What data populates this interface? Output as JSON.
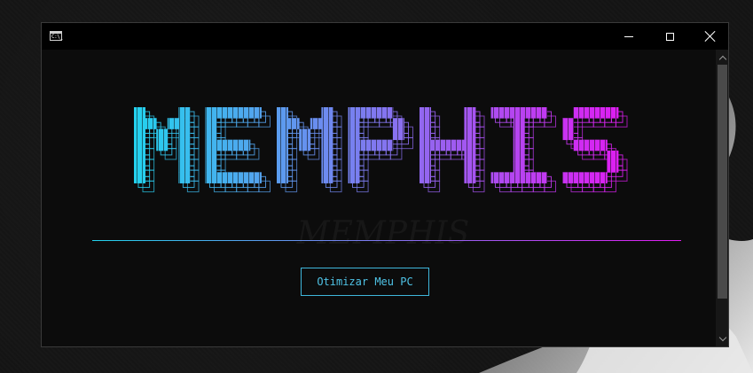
{
  "window": {
    "icon_text": "C:\\_"
  },
  "banner": {
    "letters": [
      "M",
      "E",
      "M",
      "P",
      "H",
      "I",
      "S"
    ],
    "gradient_start": "#22d3ee",
    "gradient_end": "#e11bf2",
    "watermark": "MEMPHIS"
  },
  "actions": {
    "optimize_label": "Otimizar Meu PC"
  },
  "colors": {
    "accent": "#3fb7dc",
    "window_bg": "#0c0c0c",
    "titlebar_bg": "#000000"
  }
}
